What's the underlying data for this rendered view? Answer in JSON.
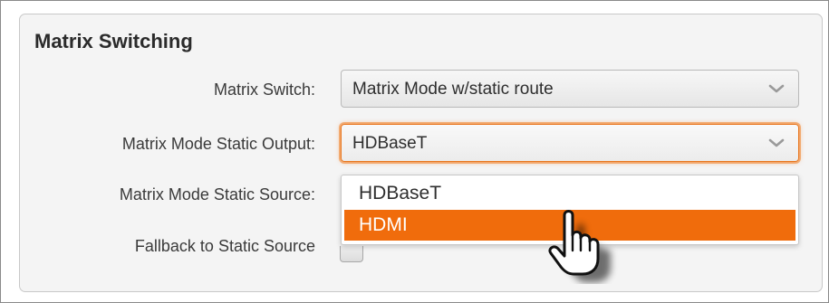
{
  "panel": {
    "title": "Matrix Switching"
  },
  "fields": {
    "matrix_switch": {
      "label": "Matrix Switch:",
      "value": "Matrix Mode w/static route"
    },
    "static_output": {
      "label": "Matrix Mode Static Output:",
      "value": "HDBaseT"
    },
    "static_source": {
      "label": "Matrix Mode Static Source:"
    },
    "fallback": {
      "label": "Fallback to Static Source"
    }
  },
  "dropdown": {
    "options": [
      "HDBaseT",
      "HDMI"
    ],
    "highlighted": "HDMI"
  },
  "colors": {
    "accent": "#f06c0c",
    "focus_ring": "#e8761e",
    "panel_bg": "#f4f4f4"
  },
  "icons": {
    "select_arrow": "chevron-down-icon",
    "pointer": "hand-pointer-cursor-icon"
  }
}
